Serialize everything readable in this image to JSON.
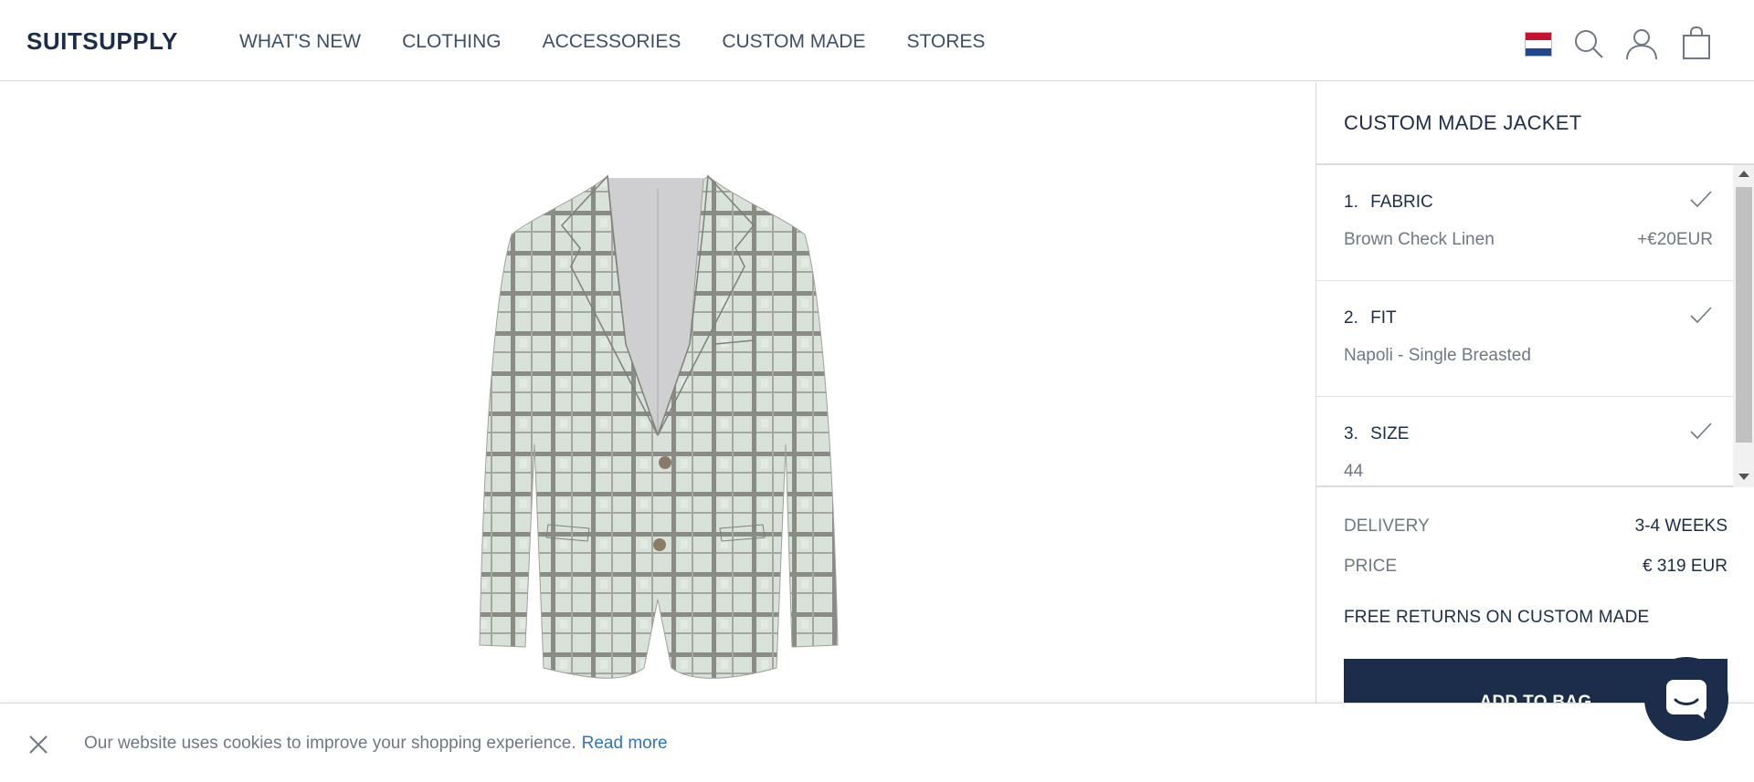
{
  "header": {
    "logo": "SUITSUPPLY",
    "nav": [
      "WHAT'S NEW",
      "CLOTHING",
      "ACCESSORIES",
      "CUSTOM MADE",
      "STORES"
    ],
    "icons": [
      "flag-netherlands-icon",
      "search-icon",
      "user-icon",
      "shopping-bag-icon"
    ]
  },
  "product": {
    "image": "jacket-image"
  },
  "panel": {
    "title": "CUSTOM MADE JACKET",
    "steps": [
      {
        "number": "1.",
        "label": "FABRIC",
        "value": "Brown Check Linen",
        "price": "+€20EUR"
      },
      {
        "number": "2.",
        "label": "FIT",
        "value": "Napoli - Single Breasted",
        "price": ""
      },
      {
        "number": "3.",
        "label": "SIZE",
        "value": "44",
        "price": ""
      }
    ],
    "delivery_label": "DELIVERY",
    "delivery_value": "3-4 WEEKS",
    "price_label": "PRICE",
    "price_value": "€ 319 EUR",
    "free_returns": "FREE RETURNS ON CUSTOM MADE",
    "add_to_bag": "ADD TO BAG"
  },
  "cookie": {
    "text": "Our website uses cookies to improve your shopping experience.",
    "link": "Read more"
  },
  "colors": {
    "navy": "#1b2d4a",
    "muted": "#6f7784",
    "link": "#2e74c7"
  }
}
